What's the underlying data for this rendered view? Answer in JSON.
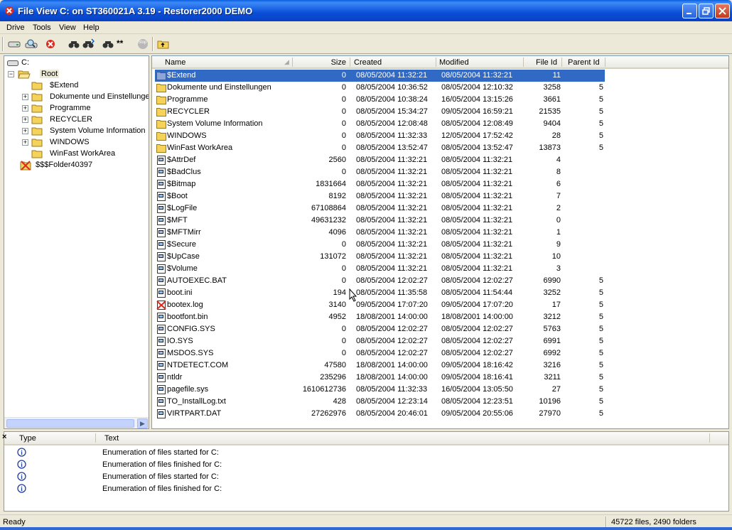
{
  "window": {
    "title": "File View C: on ST360021A 3.19 - Restorer2000 DEMO",
    "icon": "restorer-app-icon"
  },
  "menu": [
    "Drive",
    "Tools",
    "View",
    "Help"
  ],
  "toolbar": {
    "icons": [
      "drive-icon",
      "scan-icon",
      "recover-icon",
      "find-icon",
      "find-next-icon",
      "find-mask-icon",
      "stop-icon",
      "up-folder-icon"
    ],
    "find_mask_label": "**",
    "stop_label": "Stop"
  },
  "tree": {
    "drive_label": "C:",
    "root_label": "Root",
    "items": [
      {
        "label": "$Extend",
        "expandable": false
      },
      {
        "label": "Dokumente und Einstellungen",
        "expandable": true
      },
      {
        "label": "Programme",
        "expandable": true
      },
      {
        "label": "RECYCLER",
        "expandable": true
      },
      {
        "label": "System Volume Information",
        "expandable": true
      },
      {
        "label": "WINDOWS",
        "expandable": true
      },
      {
        "label": "WinFast WorkArea",
        "expandable": false
      }
    ],
    "lost_folder": "$$$Folder40397"
  },
  "list": {
    "columns": {
      "name": "Name",
      "size": "Size",
      "created": "Created",
      "modified": "Modified",
      "file_id": "File Id",
      "parent_id": "Parent Id"
    },
    "rows": [
      {
        "type": "folder",
        "name": "$Extend",
        "size": "0",
        "created": "08/05/2004 11:32:21",
        "modified": "08/05/2004 11:32:21",
        "file_id": "11",
        "parent_id": "",
        "selected": true
      },
      {
        "type": "folder",
        "name": "Dokumente und Einstellungen",
        "size": "0",
        "created": "08/05/2004 10:36:52",
        "modified": "08/05/2004 12:10:32",
        "file_id": "3258",
        "parent_id": "5"
      },
      {
        "type": "folder",
        "name": "Programme",
        "size": "0",
        "created": "08/05/2004 10:38:24",
        "modified": "16/05/2004 13:15:26",
        "file_id": "3661",
        "parent_id": "5"
      },
      {
        "type": "folder",
        "name": "RECYCLER",
        "size": "0",
        "created": "08/05/2004 15:34:27",
        "modified": "09/05/2004 16:59:21",
        "file_id": "21535",
        "parent_id": "5"
      },
      {
        "type": "folder",
        "name": "System Volume Information",
        "size": "0",
        "created": "08/05/2004 12:08:48",
        "modified": "08/05/2004 12:08:49",
        "file_id": "9404",
        "parent_id": "5"
      },
      {
        "type": "folder",
        "name": "WINDOWS",
        "size": "0",
        "created": "08/05/2004 11:32:33",
        "modified": "12/05/2004 17:52:42",
        "file_id": "28",
        "parent_id": "5"
      },
      {
        "type": "folder",
        "name": "WinFast WorkArea",
        "size": "0",
        "created": "08/05/2004 13:52:47",
        "modified": "08/05/2004 13:52:47",
        "file_id": "13873",
        "parent_id": "5"
      },
      {
        "type": "file",
        "name": "$AttrDef",
        "size": "2560",
        "created": "08/05/2004 11:32:21",
        "modified": "08/05/2004 11:32:21",
        "file_id": "4",
        "parent_id": ""
      },
      {
        "type": "file",
        "name": "$BadClus",
        "size": "0",
        "created": "08/05/2004 11:32:21",
        "modified": "08/05/2004 11:32:21",
        "file_id": "8",
        "parent_id": ""
      },
      {
        "type": "file",
        "name": "$Bitmap",
        "size": "1831664",
        "created": "08/05/2004 11:32:21",
        "modified": "08/05/2004 11:32:21",
        "file_id": "6",
        "parent_id": ""
      },
      {
        "type": "file",
        "name": "$Boot",
        "size": "8192",
        "created": "08/05/2004 11:32:21",
        "modified": "08/05/2004 11:32:21",
        "file_id": "7",
        "parent_id": ""
      },
      {
        "type": "file",
        "name": "$LogFile",
        "size": "67108864",
        "created": "08/05/2004 11:32:21",
        "modified": "08/05/2004 11:32:21",
        "file_id": "2",
        "parent_id": ""
      },
      {
        "type": "file",
        "name": "$MFT",
        "size": "49631232",
        "created": "08/05/2004 11:32:21",
        "modified": "08/05/2004 11:32:21",
        "file_id": "0",
        "parent_id": ""
      },
      {
        "type": "file",
        "name": "$MFTMirr",
        "size": "4096",
        "created": "08/05/2004 11:32:21",
        "modified": "08/05/2004 11:32:21",
        "file_id": "1",
        "parent_id": ""
      },
      {
        "type": "file",
        "name": "$Secure",
        "size": "0",
        "created": "08/05/2004 11:32:21",
        "modified": "08/05/2004 11:32:21",
        "file_id": "9",
        "parent_id": ""
      },
      {
        "type": "file",
        "name": "$UpCase",
        "size": "131072",
        "created": "08/05/2004 11:32:21",
        "modified": "08/05/2004 11:32:21",
        "file_id": "10",
        "parent_id": ""
      },
      {
        "type": "file",
        "name": "$Volume",
        "size": "0",
        "created": "08/05/2004 11:32:21",
        "modified": "08/05/2004 11:32:21",
        "file_id": "3",
        "parent_id": ""
      },
      {
        "type": "file",
        "name": "AUTOEXEC.BAT",
        "size": "0",
        "created": "08/05/2004 12:02:27",
        "modified": "08/05/2004 12:02:27",
        "file_id": "6990",
        "parent_id": "5"
      },
      {
        "type": "file",
        "name": "boot.ini",
        "size": "194",
        "created": "08/05/2004 11:35:58",
        "modified": "08/05/2004 11:54:44",
        "file_id": "3252",
        "parent_id": "5"
      },
      {
        "type": "deleted",
        "name": "bootex.log",
        "size": "3140",
        "created": "09/05/2004 17:07:20",
        "modified": "09/05/2004 17:07:20",
        "file_id": "17",
        "parent_id": "5"
      },
      {
        "type": "file",
        "name": "bootfont.bin",
        "size": "4952",
        "created": "18/08/2001 14:00:00",
        "modified": "18/08/2001 14:00:00",
        "file_id": "3212",
        "parent_id": "5"
      },
      {
        "type": "file",
        "name": "CONFIG.SYS",
        "size": "0",
        "created": "08/05/2004 12:02:27",
        "modified": "08/05/2004 12:02:27",
        "file_id": "5763",
        "parent_id": "5"
      },
      {
        "type": "file",
        "name": "IO.SYS",
        "size": "0",
        "created": "08/05/2004 12:02:27",
        "modified": "08/05/2004 12:02:27",
        "file_id": "6991",
        "parent_id": "5"
      },
      {
        "type": "file",
        "name": "MSDOS.SYS",
        "size": "0",
        "created": "08/05/2004 12:02:27",
        "modified": "08/05/2004 12:02:27",
        "file_id": "6992",
        "parent_id": "5"
      },
      {
        "type": "file",
        "name": "NTDETECT.COM",
        "size": "47580",
        "created": "18/08/2001 14:00:00",
        "modified": "09/05/2004 18:16:42",
        "file_id": "3216",
        "parent_id": "5"
      },
      {
        "type": "file",
        "name": "ntldr",
        "size": "235296",
        "created": "18/08/2001 14:00:00",
        "modified": "09/05/2004 18:16:41",
        "file_id": "3211",
        "parent_id": "5"
      },
      {
        "type": "file",
        "name": "pagefile.sys",
        "size": "1610612736",
        "created": "08/05/2004 11:32:33",
        "modified": "16/05/2004 13:05:50",
        "file_id": "27",
        "parent_id": "5"
      },
      {
        "type": "file",
        "name": "TO_InstallLog.txt",
        "size": "428",
        "created": "08/05/2004 12:23:14",
        "modified": "08/05/2004 12:23:51",
        "file_id": "10196",
        "parent_id": "5"
      },
      {
        "type": "file",
        "name": "VIRTPART.DAT",
        "size": "27262976",
        "created": "08/05/2004 20:46:01",
        "modified": "09/05/2004 20:55:06",
        "file_id": "27970",
        "parent_id": "5"
      }
    ]
  },
  "log": {
    "close_glyph": "×",
    "columns": {
      "type": "Type",
      "text": "Text"
    },
    "rows": [
      {
        "icon": "info-icon",
        "text": "Enumeration of files started for C:"
      },
      {
        "icon": "info-icon",
        "text": "Enumeration of files finished for C:"
      },
      {
        "icon": "info-icon",
        "text": "Enumeration of files started for C:"
      },
      {
        "icon": "info-icon",
        "text": "Enumeration of files finished for C:"
      }
    ]
  },
  "status": {
    "left": "Ready",
    "right": "45722 files, 2490 folders"
  },
  "colors": {
    "title_bar": "#0a4ed8",
    "selection": "#316ac5",
    "folder": "#f5d35a",
    "chrome": "#ece9d8"
  }
}
